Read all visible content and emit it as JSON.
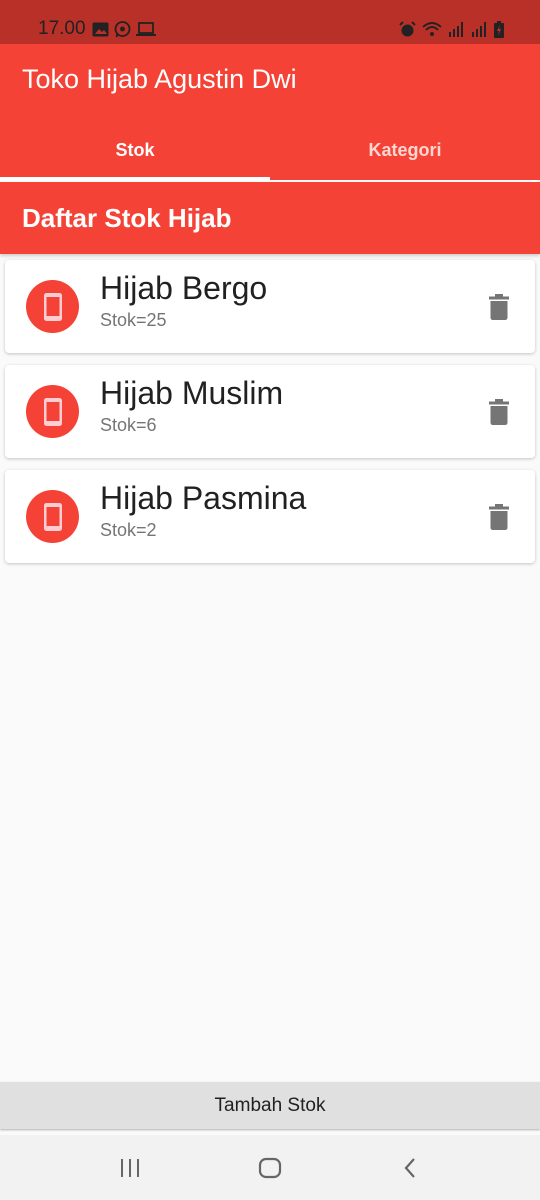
{
  "status_bar": {
    "time": "17.00",
    "left_icons": [
      "image-icon",
      "whatsapp-icon",
      "laptop-icon"
    ],
    "right_icons": [
      "alarm-icon",
      "wifi-icon",
      "signal-icon",
      "signal-icon",
      "battery-charging-icon"
    ]
  },
  "app_bar": {
    "title": "Toko Hijab Agustin Dwi",
    "background_color": "#f44336"
  },
  "tabs": [
    {
      "label": "Stok",
      "active": true
    },
    {
      "label": "Kategori",
      "active": false
    }
  ],
  "section": {
    "title": "Daftar Stok Hijab"
  },
  "items": [
    {
      "name": "Hijab Bergo",
      "stock": "Stok=25",
      "icon": "phone-android-icon",
      "action_icon": "delete-icon"
    },
    {
      "name": "Hijab Muslim",
      "stock": "Stok=6",
      "icon": "phone-android-icon",
      "action_icon": "delete-icon"
    },
    {
      "name": "Hijab Pasmina",
      "stock": "Stok=2",
      "icon": "phone-android-icon",
      "action_icon": "delete-icon"
    }
  ],
  "bottom_button": {
    "label": "Tambah Stok"
  },
  "nav_bar": {
    "buttons": [
      "recent-apps-icon",
      "home-icon",
      "back-icon"
    ]
  }
}
